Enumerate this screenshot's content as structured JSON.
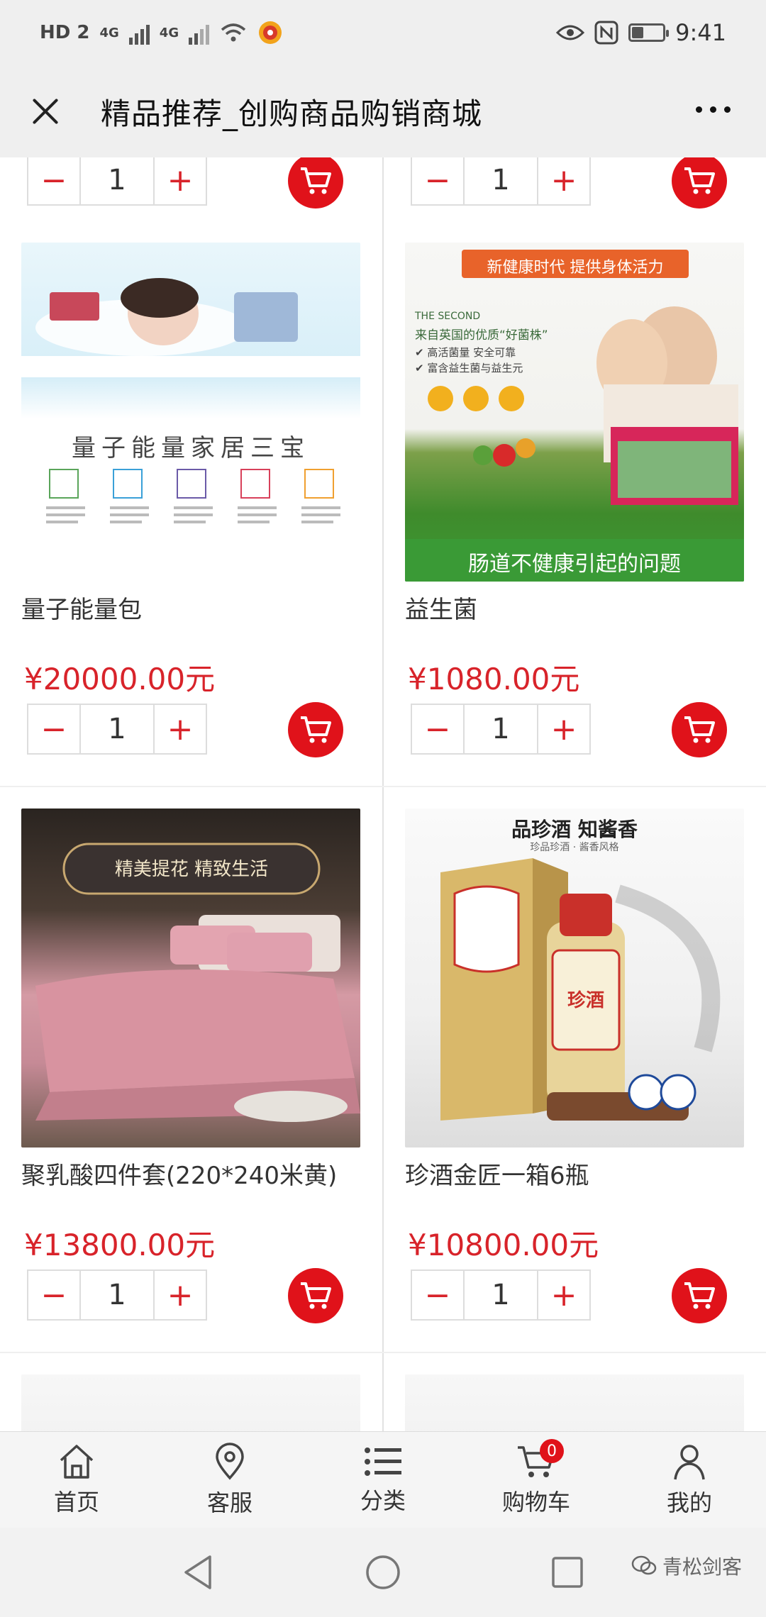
{
  "status_bar": {
    "network_left": "HD 2",
    "signal_1": "4G",
    "signal_2": "4G",
    "time": "9:41"
  },
  "title_bar": {
    "title": "精品推荐_创购商品购销商城"
  },
  "products_top_partial": [
    {
      "quantity": "1"
    },
    {
      "quantity": "1"
    }
  ],
  "products": [
    {
      "name": "量子能量包",
      "price": "¥20000.00元",
      "quantity": "1",
      "image_caption": "量子能量家居三宝"
    },
    {
      "name": "益生菌",
      "price": "¥1080.00元",
      "quantity": "1",
      "image_banner": "新健康时代 提供身体活力",
      "image_subtitle": "THE SECOND",
      "image_text_1": "来自英国的优质“好菌株”",
      "image_text_2": "✔ 高活菌量 安全可靠",
      "image_text_3": "✔ 富含益生菌与益生元",
      "image_caption": "肠道不健康引起的问题"
    },
    {
      "name": "聚乳酸四件套(220*240米黄)",
      "price": "¥13800.00元",
      "quantity": "1",
      "image_caption": "精美提花 精致生活"
    },
    {
      "name": "珍酒金匠一箱6瓶",
      "price": "¥10800.00元",
      "quantity": "1",
      "image_caption": "品珍酒 知酱香",
      "image_sub": "珍品珍酒 · 酱香风格",
      "bottle_label": "珍酒"
    }
  ],
  "bottom_nav": [
    {
      "label": "首页",
      "icon": "home-icon"
    },
    {
      "label": "客服",
      "icon": "location-pin-icon"
    },
    {
      "label": "分类",
      "icon": "list-icon"
    },
    {
      "label": "购物车",
      "icon": "cart-icon",
      "badge": "0"
    },
    {
      "label": "我的",
      "icon": "user-icon"
    }
  ],
  "watermark": "青松剑客",
  "colors": {
    "accent_red": "#e0121a",
    "price_red": "#d8232a"
  }
}
